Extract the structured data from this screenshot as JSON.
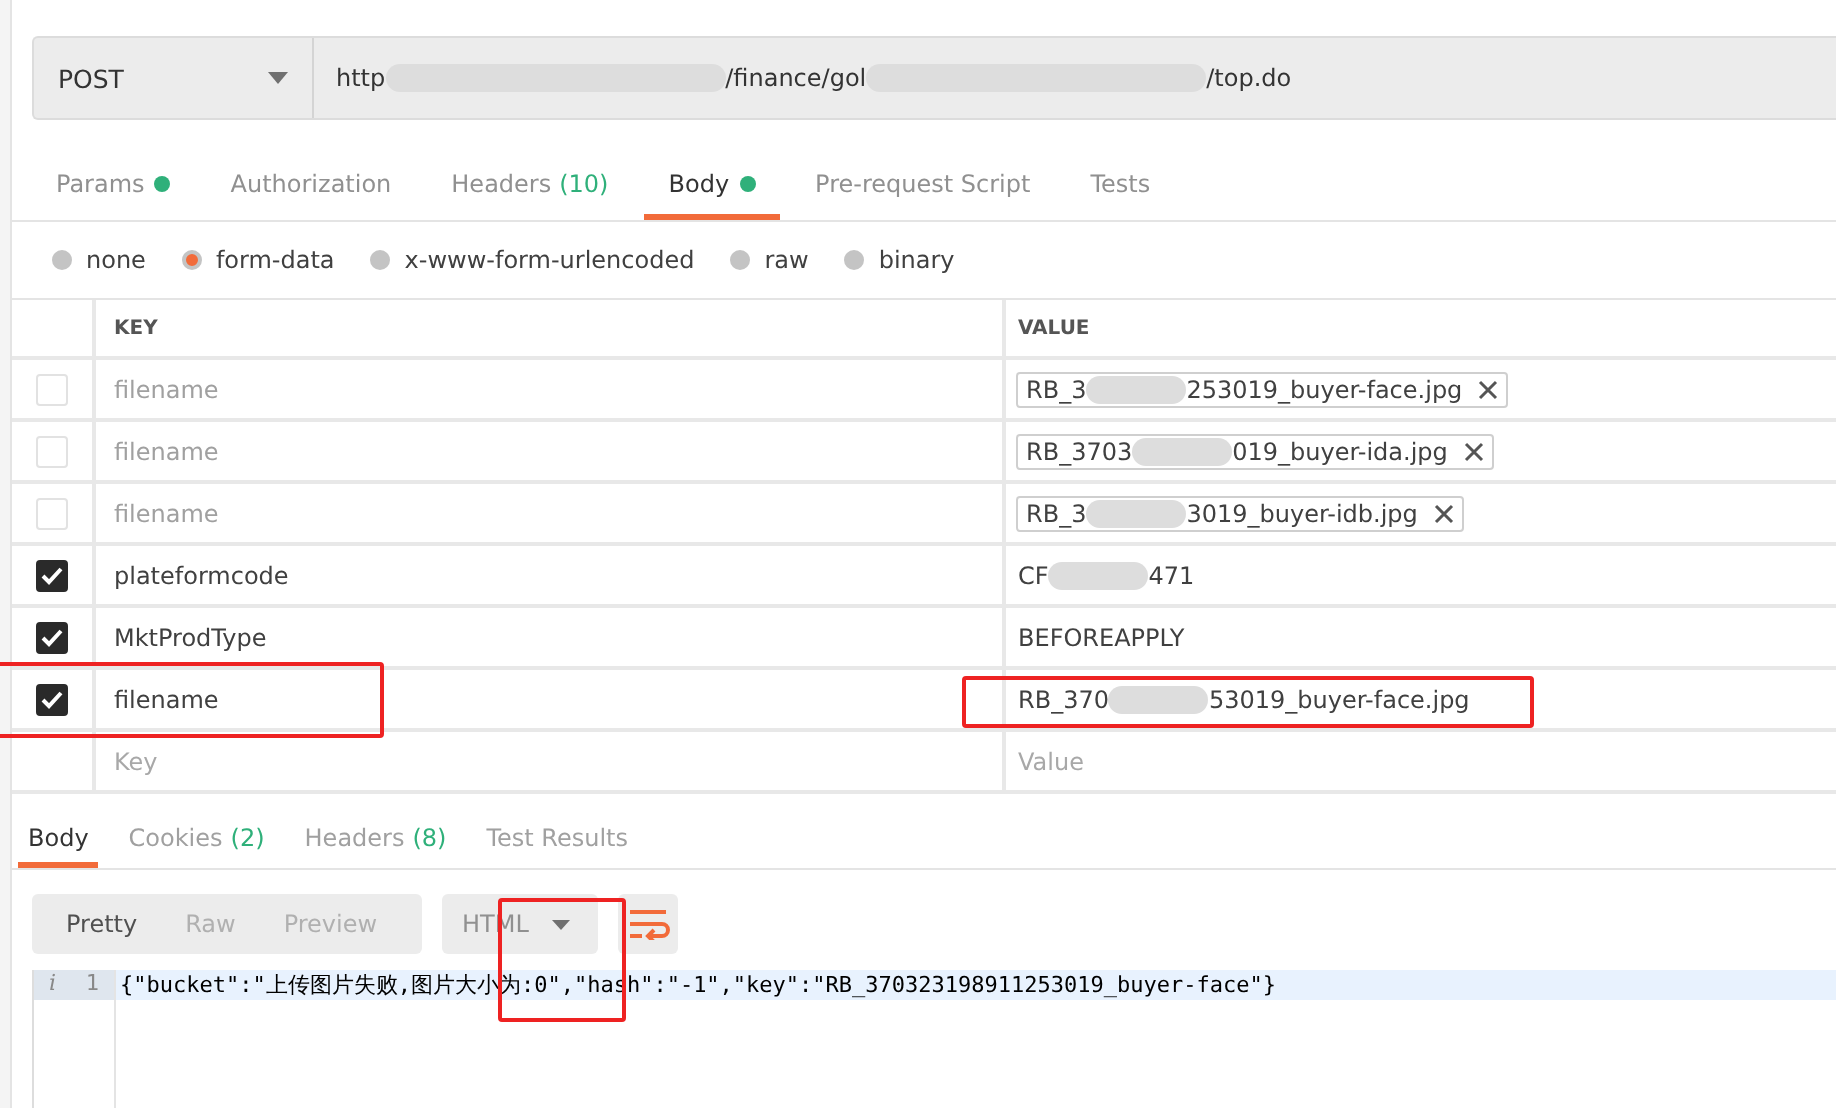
{
  "request": {
    "method": "POST",
    "url_parts": [
      "http",
      "/finance/gol",
      "/top.do"
    ]
  },
  "tabs": [
    {
      "label": "Params",
      "dot": true,
      "selected": false
    },
    {
      "label": "Authorization",
      "dot": false,
      "selected": false
    },
    {
      "label": "Headers",
      "count": "(10)",
      "dot": false,
      "selected": false
    },
    {
      "label": "Body",
      "dot": true,
      "selected": true
    },
    {
      "label": "Pre-request Script",
      "dot": false,
      "selected": false
    },
    {
      "label": "Tests",
      "dot": false,
      "selected": false
    }
  ],
  "body_types": [
    {
      "label": "none",
      "selected": false
    },
    {
      "label": "form-data",
      "selected": true
    },
    {
      "label": "x-www-form-urlencoded",
      "selected": false
    },
    {
      "label": "raw",
      "selected": false
    },
    {
      "label": "binary",
      "selected": false
    }
  ],
  "table": {
    "columns": [
      "KEY",
      "VALUE"
    ],
    "rows": [
      {
        "key": "filename",
        "checked": false,
        "kind": "file",
        "value_parts": [
          "RB_3",
          "253019_buyer-face.jpg"
        ],
        "highlighted": false
      },
      {
        "key": "filename",
        "checked": false,
        "kind": "file",
        "value_parts": [
          "RB_3703",
          "019_buyer-ida.jpg"
        ],
        "highlighted": false
      },
      {
        "key": "filename",
        "checked": false,
        "kind": "file",
        "value_parts": [
          "RB_3",
          "3019_buyer-idb.jpg"
        ],
        "highlighted": false
      },
      {
        "key": "plateformcode",
        "checked": true,
        "kind": "text",
        "value_parts": [
          "CF",
          "471"
        ],
        "highlighted": false
      },
      {
        "key": "MktProdType",
        "checked": true,
        "kind": "text",
        "value_parts": [
          "BEFOREAPPLY"
        ],
        "highlighted": false
      },
      {
        "key": "filename",
        "checked": true,
        "kind": "text",
        "value_parts": [
          "RB_370",
          "53019_buyer-face.jpg"
        ],
        "highlighted": true
      }
    ],
    "new_row": {
      "key_placeholder": "Key",
      "value_placeholder": "Value"
    }
  },
  "response": {
    "tabs": [
      {
        "label": "Body",
        "selected": true
      },
      {
        "label": "Cookies",
        "count": "(2)",
        "selected": false
      },
      {
        "label": "Headers",
        "count": "(8)",
        "selected": false
      },
      {
        "label": "Test Results",
        "selected": false
      }
    ],
    "views": [
      {
        "label": "Pretty",
        "selected": true
      },
      {
        "label": "Raw",
        "selected": false
      },
      {
        "label": "Preview",
        "selected": false
      }
    ],
    "format": "HTML",
    "format_highlighted": true,
    "lines": [
      {
        "marker": "i",
        "number": "1",
        "text": "{\"bucket\":\"上传图片失败,图片大小为:0\",\"hash\":\"-1\",\"key\":\"RB_370323198911253019_buyer-face\"}"
      }
    ]
  }
}
